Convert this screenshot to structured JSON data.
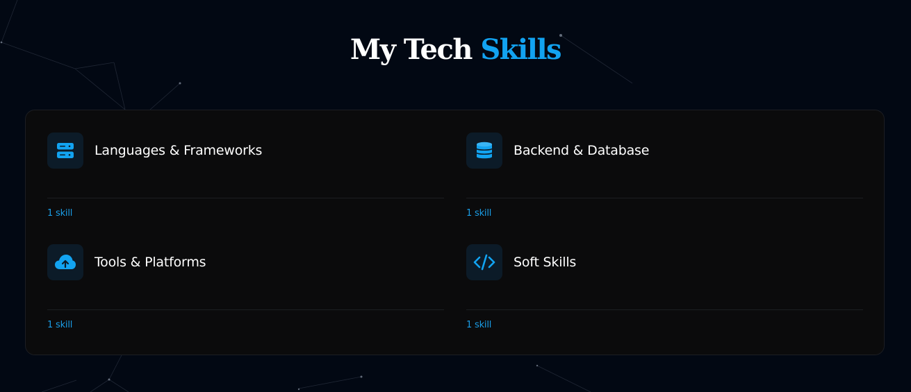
{
  "header": {
    "title_part1": "My Tech ",
    "title_part2": "Skills"
  },
  "colors": {
    "background": "#020813",
    "panel": "#0b0b0c",
    "accent": "#12a3f1",
    "icon_tile": "#0c1b28"
  },
  "categories": [
    {
      "title": "Languages & Frameworks",
      "count": "1 skill",
      "icon": "server-icon"
    },
    {
      "title": "Backend & Database",
      "count": "1 skill",
      "icon": "database-icon"
    },
    {
      "title": "Tools & Platforms",
      "count": "1 skill",
      "icon": "cloud-upload-icon"
    },
    {
      "title": "Soft Skills",
      "count": "1 skill",
      "icon": "code-icon"
    }
  ]
}
